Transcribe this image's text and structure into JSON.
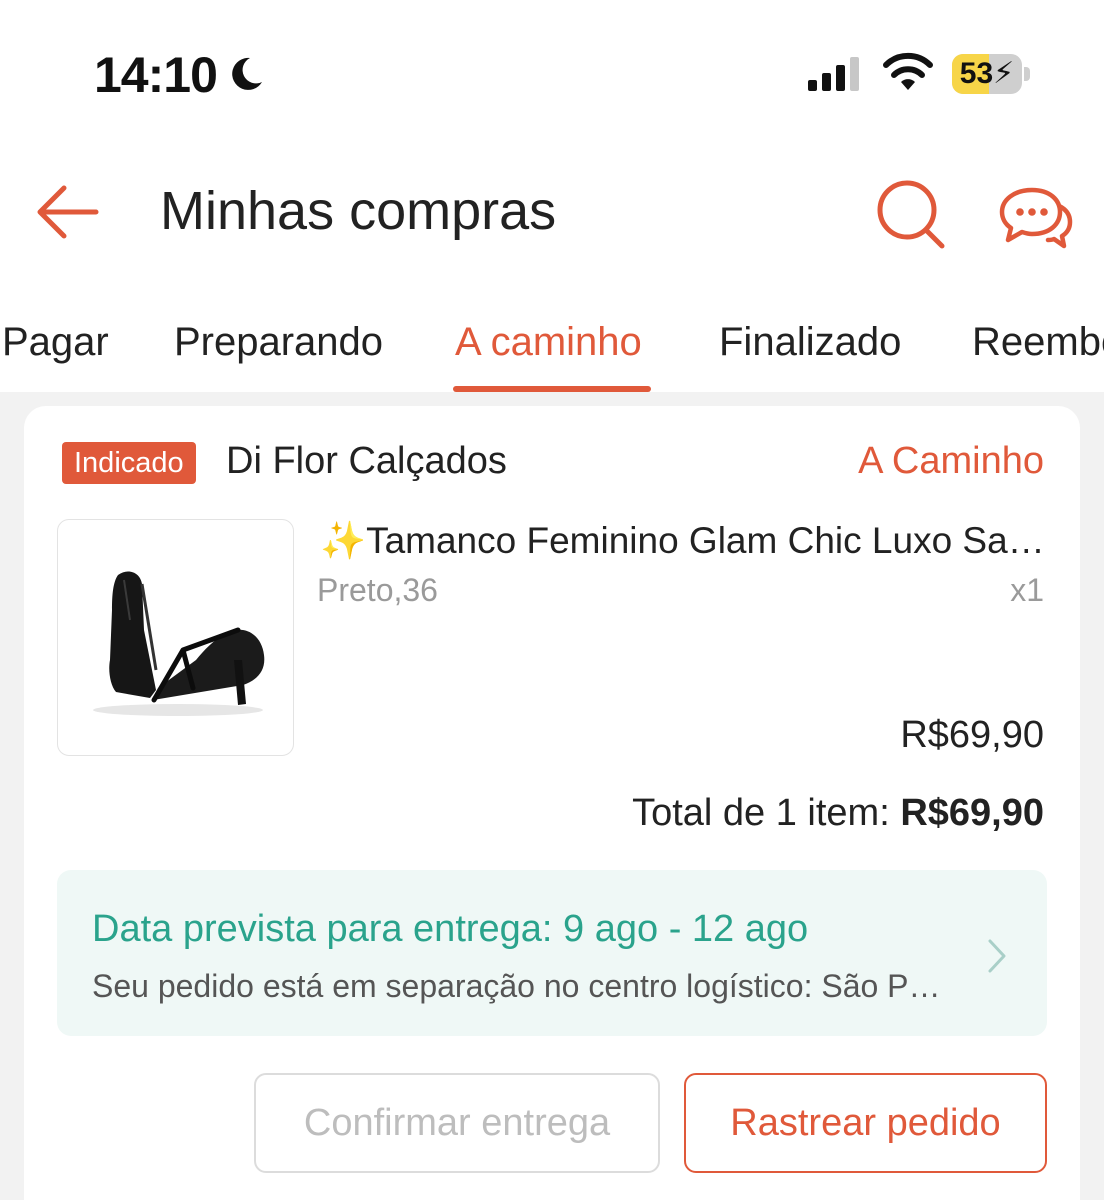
{
  "status_bar": {
    "time": "14:10",
    "battery_percent": "53",
    "battery_level": 0.53
  },
  "header": {
    "title": "Minhas compras",
    "back_icon": "arrow-left-icon",
    "search_icon": "search-icon",
    "chat_icon": "chat-bubbles-icon"
  },
  "tabs": [
    {
      "label": "Pagar",
      "active": false
    },
    {
      "label": "Preparando",
      "active": false
    },
    {
      "label": "A caminho",
      "active": true
    },
    {
      "label": "Finalizado",
      "active": false
    },
    {
      "label": "Reembolso",
      "active": false
    }
  ],
  "order": {
    "badge": "Indicado",
    "shop_name": "Di Flor Calçados",
    "status": "A Caminho",
    "product": {
      "name": "✨Tamanco Feminino Glam Chic Luxo Salto Bloco",
      "variant": "Preto,36",
      "quantity": "x1",
      "price": "R$69,90"
    },
    "total_label": "Total de 1 item:",
    "total_value": "R$69,90",
    "delivery": {
      "title": "Data prevista para entrega: 9 ago - 12 ago",
      "subtitle": "Seu pedido está em separação no centro logístico: São Paulo"
    },
    "buttons": {
      "confirm": "Confirmar entrega",
      "track": "Rastrear pedido"
    }
  },
  "colors": {
    "accent": "#e0593a",
    "delivery_text": "#2aa38c",
    "delivery_bg": "#eff8f6",
    "battery_fill": "#f7d548"
  }
}
